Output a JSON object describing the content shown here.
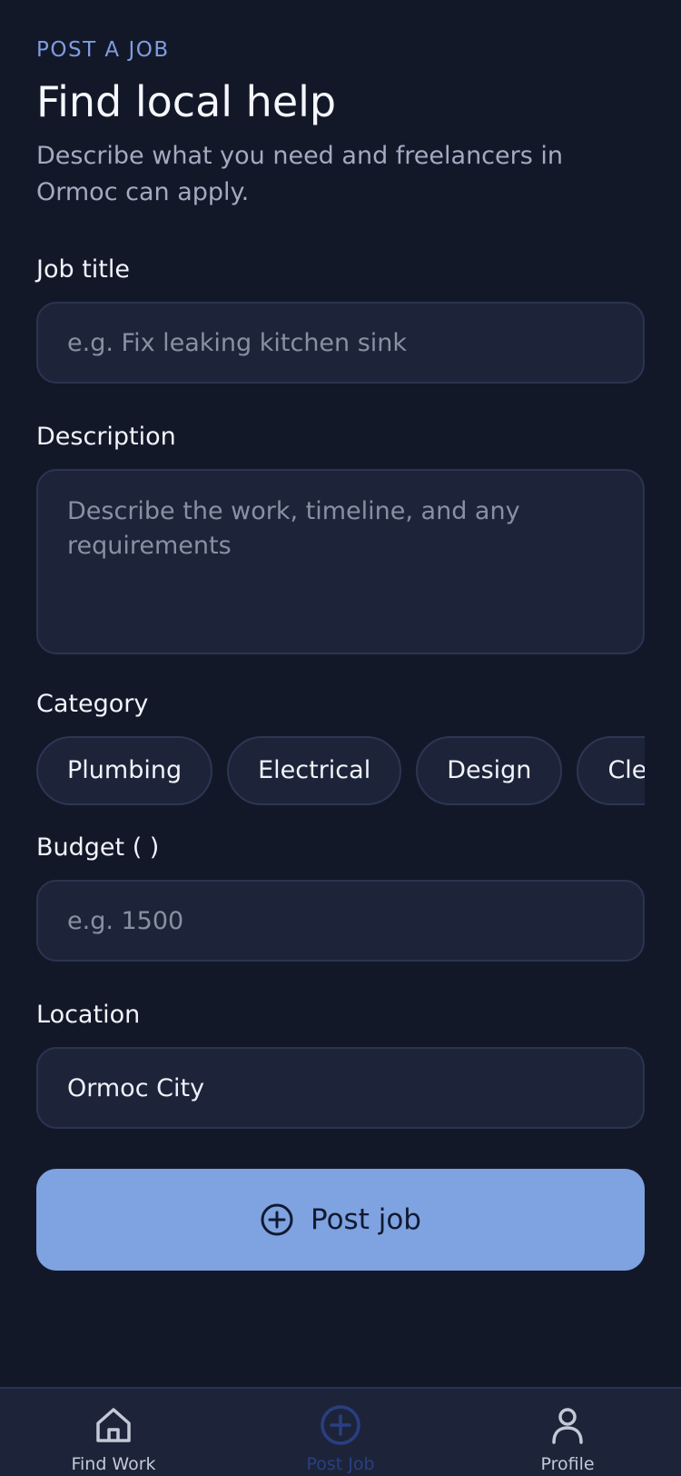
{
  "header": {
    "eyebrow": "POST A JOB",
    "title": "Find local help",
    "subtitle": "Describe what you need and freelancers in Ormoc can apply."
  },
  "form": {
    "job_title": {
      "label": "Job title",
      "placeholder": "e.g. Fix leaking kitchen sink",
      "value": ""
    },
    "description": {
      "label": "Description",
      "placeholder": "Describe the work, timeline, and any requirements",
      "value": ""
    },
    "category": {
      "label": "Category",
      "options": [
        "Plumbing",
        "Electrical",
        "Design",
        "Clea"
      ]
    },
    "budget": {
      "label": "Budget (  )",
      "placeholder": "e.g. 1500",
      "value": ""
    },
    "location": {
      "label": "Location",
      "placeholder": "",
      "value": "Ormoc City"
    },
    "submit_label": "Post job"
  },
  "nav": {
    "items": [
      {
        "label": "Find Work",
        "icon": "home-icon",
        "active": false
      },
      {
        "label": "Post Job",
        "icon": "plus-circle-icon",
        "active": true
      },
      {
        "label": "Profile",
        "icon": "user-icon",
        "active": false
      }
    ]
  },
  "colors": {
    "background": "#131829",
    "surface": "#1d2439",
    "accent": "#7fa2e1",
    "active_nav": "#2a3f82"
  }
}
